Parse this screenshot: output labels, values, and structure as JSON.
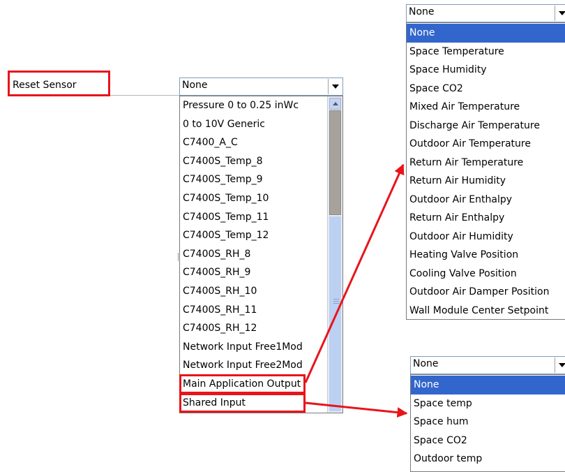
{
  "reset_sensor": {
    "label": "Reset Sensor"
  },
  "main_combo": {
    "value": "None",
    "options": [
      "Pressure 0 to 0.25 inWc",
      "0 to 10V Generic",
      "C7400_A_C",
      "C7400S_Temp_8",
      "C7400S_Temp_9",
      "C7400S_Temp_10",
      "C7400S_Temp_11",
      "C7400S_Temp_12",
      "C7400S_RH_8",
      "C7400S_RH_9",
      "C7400S_RH_10",
      "C7400S_RH_11",
      "C7400S_RH_12",
      "Network Input Free1Mod",
      "Network Input Free2Mod",
      "Main Application Output",
      "Shared Input"
    ]
  },
  "app_output_combo": {
    "value": "None",
    "options": [
      "None",
      "Space Temperature",
      "Space Humidity",
      "Space CO2",
      "Mixed Air Temperature",
      "Discharge Air Temperature",
      "Outdoor Air Temperature",
      "Return Air Temperature",
      "Return Air Humidity",
      "Outdoor Air Enthalpy",
      "Return Air Enthalpy",
      "Outdoor Air Humidity",
      "Heating Valve Position",
      "Cooling Valve Position",
      "Outdoor Air Damper Position",
      "Wall Module Center Setpoint"
    ],
    "selected": "None"
  },
  "shared_input_combo": {
    "value": "None",
    "options": [
      "None",
      "Space temp",
      "Space hum",
      "Space CO2",
      "Outdoor temp"
    ],
    "selected": "None"
  },
  "colors": {
    "highlight": "#e8141b",
    "selection": "#3266cc"
  }
}
